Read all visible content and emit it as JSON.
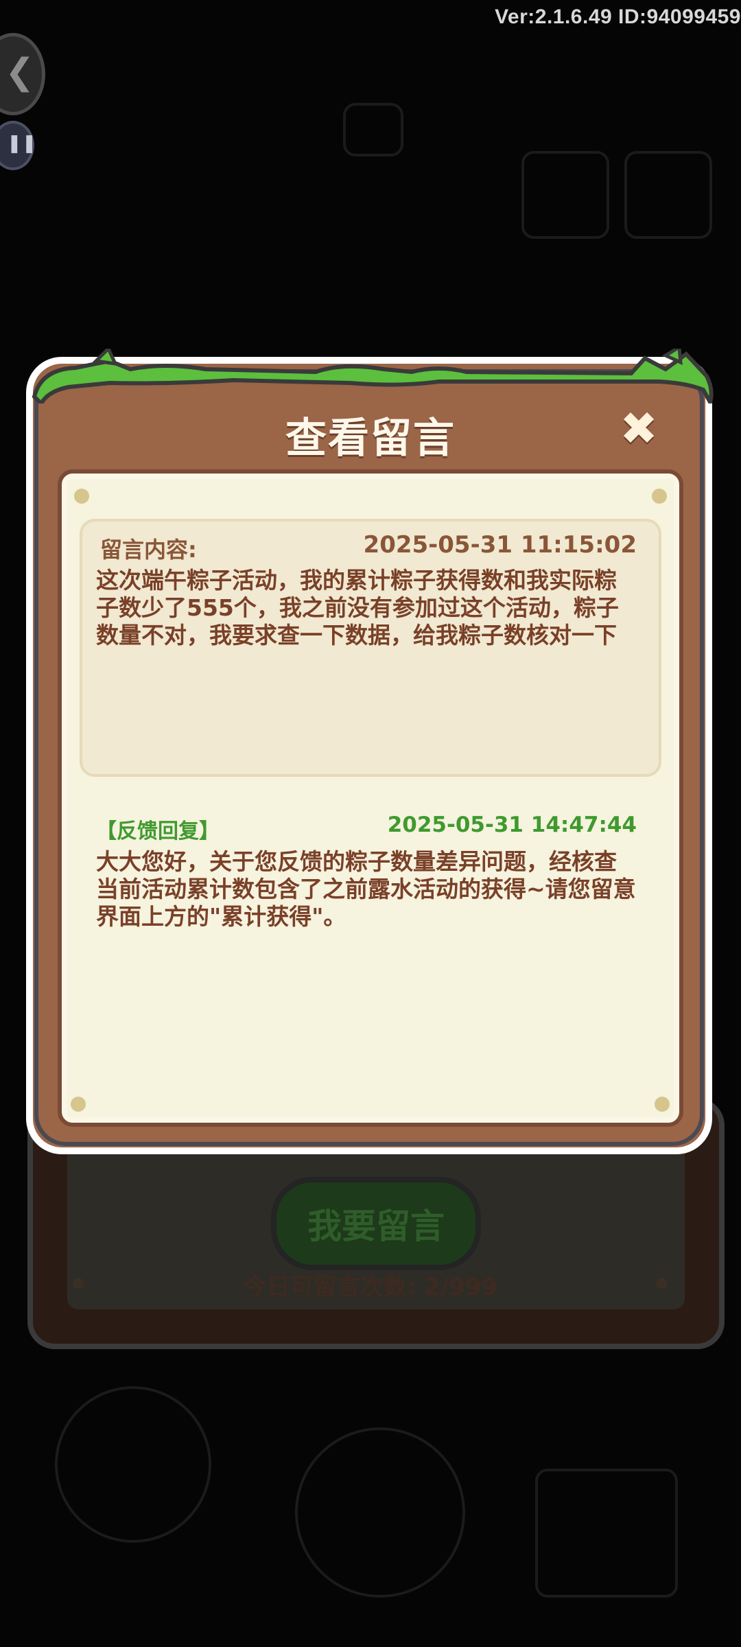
{
  "version_text": "Ver:2.1.6.49 ID:94099459",
  "modal": {
    "title": "查看留言",
    "close_symbol": "✖"
  },
  "message": {
    "label": "留言内容:",
    "timestamp": "2025-05-31 11:15:02",
    "body": "这次端午粽子活动，我的累计粽子获得数和我实际粽子数少了555个，我之前没有参加过这个活动，粽子数量不对，我要求查一下数据，给我粽子数核对一下"
  },
  "reply": {
    "label": "【反馈回复】",
    "timestamp": "2025-05-31 14:47:44",
    "body": "大大您好，关于您反馈的粽子数量差异问题，经核查当前活动累计数包含了之前露水活动的获得~请您留意界面上方的\"累计获得\"。"
  },
  "background": {
    "leave_message_button": "我要留言",
    "daily_count_text": "今日可留言次数: 2/999"
  },
  "colors": {
    "modal_frame": "#9b6548",
    "paper": "#f6f3df",
    "text_brown": "#7a4028",
    "reply_green": "#3f9a2e"
  },
  "icons": {
    "back": "back-arrow-icon",
    "pause": "pause-icon",
    "close": "close-icon"
  }
}
